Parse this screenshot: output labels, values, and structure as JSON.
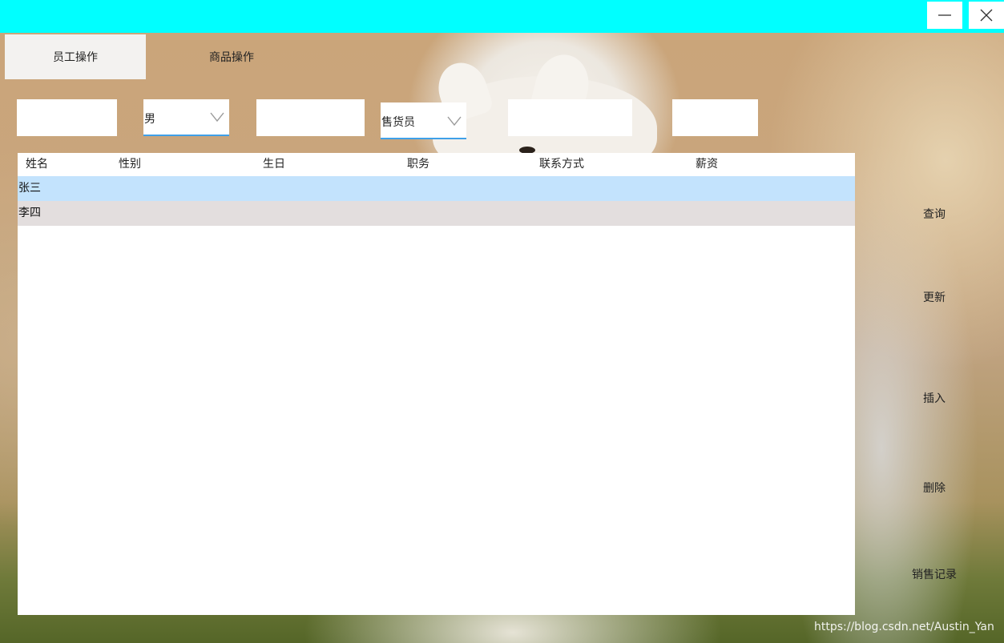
{
  "window": {
    "minimize_label": "minimize",
    "close_label": "close"
  },
  "tabs": [
    {
      "label": "员工操作",
      "active": true
    },
    {
      "label": "商品操作",
      "active": false
    }
  ],
  "filters": {
    "name_value": "",
    "gender_value": "男",
    "birthday_value": "",
    "position_value": "售货员",
    "contact_value": "",
    "salary_value": ""
  },
  "table": {
    "columns": [
      "姓名",
      "性别",
      "生日",
      "职务",
      "联系方式",
      "薪资"
    ],
    "rows": [
      {
        "name": "张三",
        "selected": true
      },
      {
        "name": "李四",
        "selected": false
      }
    ]
  },
  "actions": {
    "query": "查询",
    "update": "更新",
    "insert": "插入",
    "delete": "删除",
    "sales_record": "销售记录"
  },
  "watermark": "https://blog.csdn.net/Austin_Yan",
  "colors": {
    "titlebar": "#00ffff",
    "selected_row": "#c3e3fd",
    "second_row": "#e3dede",
    "select_underline": "#3fa0e8"
  }
}
